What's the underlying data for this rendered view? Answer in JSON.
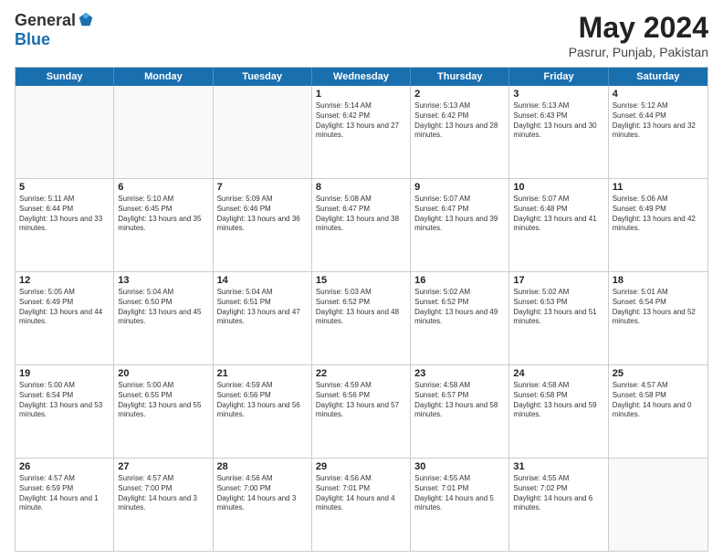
{
  "header": {
    "logo_general": "General",
    "logo_blue": "Blue",
    "title": "May 2024",
    "subtitle": "Pasrur, Punjab, Pakistan"
  },
  "weekdays": [
    "Sunday",
    "Monday",
    "Tuesday",
    "Wednesday",
    "Thursday",
    "Friday",
    "Saturday"
  ],
  "rows": [
    [
      {
        "day": "",
        "empty": true
      },
      {
        "day": "",
        "empty": true
      },
      {
        "day": "",
        "empty": true
      },
      {
        "day": "1",
        "sunrise": "5:14 AM",
        "sunset": "6:42 PM",
        "daylight": "13 hours and 27 minutes."
      },
      {
        "day": "2",
        "sunrise": "5:13 AM",
        "sunset": "6:42 PM",
        "daylight": "13 hours and 28 minutes."
      },
      {
        "day": "3",
        "sunrise": "5:13 AM",
        "sunset": "6:43 PM",
        "daylight": "13 hours and 30 minutes."
      },
      {
        "day": "4",
        "sunrise": "5:12 AM",
        "sunset": "6:44 PM",
        "daylight": "13 hours and 32 minutes."
      }
    ],
    [
      {
        "day": "5",
        "sunrise": "5:11 AM",
        "sunset": "6:44 PM",
        "daylight": "13 hours and 33 minutes."
      },
      {
        "day": "6",
        "sunrise": "5:10 AM",
        "sunset": "6:45 PM",
        "daylight": "13 hours and 35 minutes."
      },
      {
        "day": "7",
        "sunrise": "5:09 AM",
        "sunset": "6:46 PM",
        "daylight": "13 hours and 36 minutes."
      },
      {
        "day": "8",
        "sunrise": "5:08 AM",
        "sunset": "6:47 PM",
        "daylight": "13 hours and 38 minutes."
      },
      {
        "day": "9",
        "sunrise": "5:07 AM",
        "sunset": "6:47 PM",
        "daylight": "13 hours and 39 minutes."
      },
      {
        "day": "10",
        "sunrise": "5:07 AM",
        "sunset": "6:48 PM",
        "daylight": "13 hours and 41 minutes."
      },
      {
        "day": "11",
        "sunrise": "5:06 AM",
        "sunset": "6:49 PM",
        "daylight": "13 hours and 42 minutes."
      }
    ],
    [
      {
        "day": "12",
        "sunrise": "5:05 AM",
        "sunset": "6:49 PM",
        "daylight": "13 hours and 44 minutes."
      },
      {
        "day": "13",
        "sunrise": "5:04 AM",
        "sunset": "6:50 PM",
        "daylight": "13 hours and 45 minutes."
      },
      {
        "day": "14",
        "sunrise": "5:04 AM",
        "sunset": "6:51 PM",
        "daylight": "13 hours and 47 minutes."
      },
      {
        "day": "15",
        "sunrise": "5:03 AM",
        "sunset": "6:52 PM",
        "daylight": "13 hours and 48 minutes."
      },
      {
        "day": "16",
        "sunrise": "5:02 AM",
        "sunset": "6:52 PM",
        "daylight": "13 hours and 49 minutes."
      },
      {
        "day": "17",
        "sunrise": "5:02 AM",
        "sunset": "6:53 PM",
        "daylight": "13 hours and 51 minutes."
      },
      {
        "day": "18",
        "sunrise": "5:01 AM",
        "sunset": "6:54 PM",
        "daylight": "13 hours and 52 minutes."
      }
    ],
    [
      {
        "day": "19",
        "sunrise": "5:00 AM",
        "sunset": "6:54 PM",
        "daylight": "13 hours and 53 minutes."
      },
      {
        "day": "20",
        "sunrise": "5:00 AM",
        "sunset": "6:55 PM",
        "daylight": "13 hours and 55 minutes."
      },
      {
        "day": "21",
        "sunrise": "4:59 AM",
        "sunset": "6:56 PM",
        "daylight": "13 hours and 56 minutes."
      },
      {
        "day": "22",
        "sunrise": "4:59 AM",
        "sunset": "6:56 PM",
        "daylight": "13 hours and 57 minutes."
      },
      {
        "day": "23",
        "sunrise": "4:58 AM",
        "sunset": "6:57 PM",
        "daylight": "13 hours and 58 minutes."
      },
      {
        "day": "24",
        "sunrise": "4:58 AM",
        "sunset": "6:58 PM",
        "daylight": "13 hours and 59 minutes."
      },
      {
        "day": "25",
        "sunrise": "4:57 AM",
        "sunset": "6:58 PM",
        "daylight": "14 hours and 0 minutes."
      }
    ],
    [
      {
        "day": "26",
        "sunrise": "4:57 AM",
        "sunset": "6:59 PM",
        "daylight": "14 hours and 1 minute."
      },
      {
        "day": "27",
        "sunrise": "4:57 AM",
        "sunset": "7:00 PM",
        "daylight": "14 hours and 3 minutes."
      },
      {
        "day": "28",
        "sunrise": "4:56 AM",
        "sunset": "7:00 PM",
        "daylight": "14 hours and 3 minutes."
      },
      {
        "day": "29",
        "sunrise": "4:56 AM",
        "sunset": "7:01 PM",
        "daylight": "14 hours and 4 minutes."
      },
      {
        "day": "30",
        "sunrise": "4:55 AM",
        "sunset": "7:01 PM",
        "daylight": "14 hours and 5 minutes."
      },
      {
        "day": "31",
        "sunrise": "4:55 AM",
        "sunset": "7:02 PM",
        "daylight": "14 hours and 6 minutes."
      },
      {
        "day": "",
        "empty": true
      }
    ]
  ]
}
